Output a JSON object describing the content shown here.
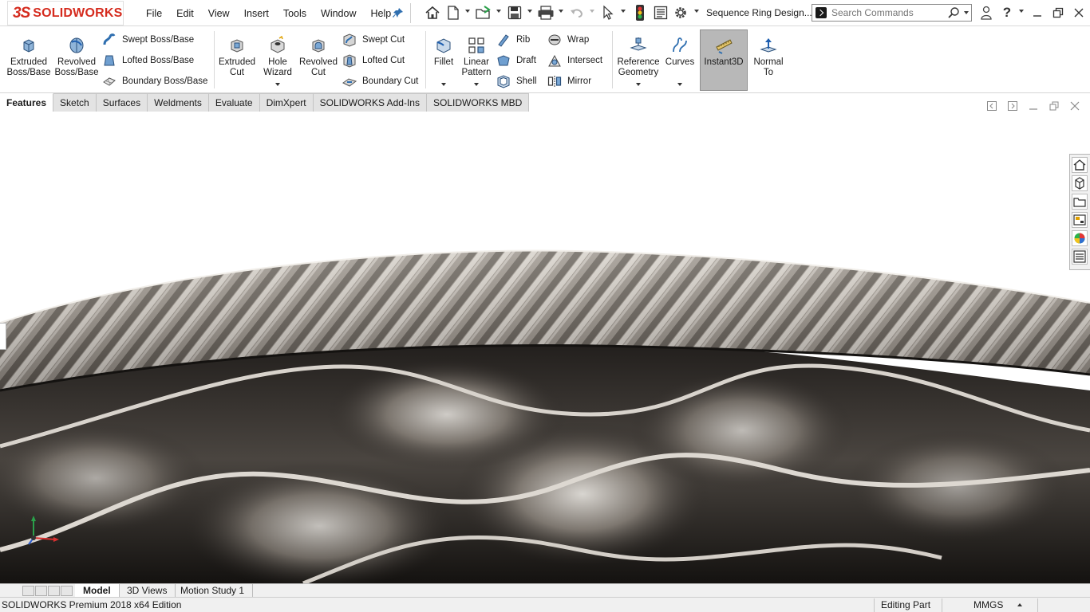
{
  "app": {
    "logo_prefix": "3S",
    "logo_text": "SOLIDWORKS",
    "document_title": "Sequence Ring Design..."
  },
  "menu": [
    "File",
    "Edit",
    "View",
    "Insert",
    "Tools",
    "Window",
    "Help"
  ],
  "search": {
    "placeholder": "Search Commands"
  },
  "ribbon": {
    "extruded_boss": "Extruded\nBoss/Base",
    "revolved_boss": "Revolved\nBoss/Base",
    "swept_boss": "Swept Boss/Base",
    "lofted_boss": "Lofted Boss/Base",
    "boundary_boss": "Boundary Boss/Base",
    "extruded_cut": "Extruded\nCut",
    "hole_wizard": "Hole\nWizard",
    "revolved_cut": "Revolved\nCut",
    "swept_cut": "Swept Cut",
    "lofted_cut": "Lofted Cut",
    "boundary_cut": "Boundary Cut",
    "fillet": "Fillet",
    "linear_pattern": "Linear\nPattern",
    "rib": "Rib",
    "draft": "Draft",
    "shell": "Shell",
    "wrap": "Wrap",
    "intersect": "Intersect",
    "mirror": "Mirror",
    "reference_geometry": "Reference\nGeometry",
    "curves": "Curves",
    "instant3d": "Instant3D",
    "normal_to": "Normal\nTo"
  },
  "tabs": [
    "Features",
    "Sketch",
    "Surfaces",
    "Weldments",
    "Evaluate",
    "DimXpert",
    "SOLIDWORKS Add-Ins",
    "SOLIDWORKS MBD"
  ],
  "active_tab": "Features",
  "bottom_tabs": [
    "Model",
    "3D Views",
    "Motion Study 1"
  ],
  "active_bottom_tab": "Model",
  "status": {
    "edition": "SOLIDWORKS Premium 2018 x64 Edition",
    "mode": "Editing Part",
    "units": "MMGS"
  },
  "colors": {
    "brand_red": "#d52b1e",
    "icon_blue": "#2f6fb0",
    "instant3d_active": "#b8b8b8"
  },
  "icons": [
    "home-icon",
    "new-document-icon",
    "open-icon",
    "save-icon",
    "print-icon",
    "undo-icon",
    "select-icon",
    "rebuild-icon",
    "file-properties-icon",
    "options-icon",
    "user-icon",
    "help-icon"
  ]
}
